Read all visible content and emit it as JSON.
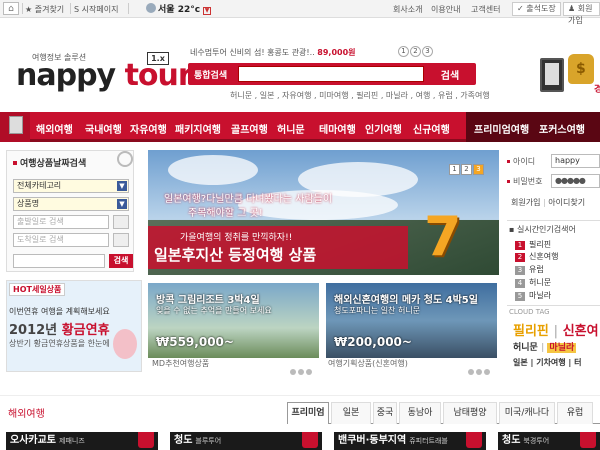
{
  "topbar": {
    "favorites": "즐겨찾기",
    "start_page": "시작페이지",
    "weather_city": "서울",
    "weather_temp": "22°c",
    "links": [
      "회사소개",
      "이용안내",
      "고객센터"
    ],
    "attendance": "출석도장",
    "member": "회원가입"
  },
  "logo": {
    "slogan": "여행정보 솔루션",
    "word_a": "nappy",
    "word_b": "tour",
    "version": "1.x"
  },
  "ticker": {
    "text": "네수멈투어  신비의 섬! 홍콩도 관광!..",
    "points": "89,000원",
    "page_nums": [
      "1",
      "2",
      "3"
    ]
  },
  "search": {
    "label": "통합검색",
    "placeholder": "",
    "button": "검색",
    "keywords": "허니문 , 일본 , 자유여행 , 미마여행 , 필리핀 , 마닐라 , 여행 , 유럽 , 가족여행"
  },
  "right_ad": {
    "text": "경"
  },
  "nav": {
    "items": [
      "해외여행",
      "국내여행",
      "자유여행",
      "패키지여행",
      "골프여행",
      "허니문",
      "테마여행",
      "인기여행",
      "신규여행",
      "프리미엄여행",
      "포커스여행"
    ]
  },
  "left_search": {
    "title": "여행상품날짜검색",
    "select_all": "전체카테고리",
    "select_product": "상품명",
    "depart_date": "출발일로 검색",
    "arrive_date": "도착일로 검색",
    "button": "검색"
  },
  "hot_deal": {
    "tab": "HOT세일상품",
    "line1": "이번연휴 여행을 계획해보세요",
    "line2_year": "2012년",
    "line2_word": "황금연휴",
    "line3": "상반기 황금연휴상품을 한눈에"
  },
  "banner": {
    "line1": "일본여행?다닐만큼 다녀봤다는 사람들이",
    "line2": "주목해야할 그 곳!",
    "line3": "가을여행의 정취를 만끽하자!!",
    "line4": "일본후지산 등정여행 상품",
    "big_number": "7",
    "pager": [
      "1",
      "2",
      "3"
    ]
  },
  "thumbs": [
    {
      "headline": "방콕 그림리조트 3박4일",
      "sub": "잊을 수 없는 추억을 만들어 보세요",
      "price": "₩559,000~",
      "caption": "MD추천여행상품"
    },
    {
      "headline": "해외신혼여행의 메카 청도 4박5일",
      "sub": "청도포파니는 일찬 허니문",
      "price": "₩200,000~",
      "caption": "여행기획상품(신혼여행)"
    }
  ],
  "login": {
    "id_label": "아이디",
    "id_value": "happy",
    "pw_label": "비밀번호",
    "pw_value": "●●●●●",
    "join": "회원가입",
    "find": "아이디찾기"
  },
  "ranking": {
    "title": "실시간인기검색어",
    "items": [
      {
        "n": "1",
        "t": "필리핀"
      },
      {
        "n": "2",
        "t": "신혼여행"
      },
      {
        "n": "3",
        "t": "유럽"
      },
      {
        "n": "4",
        "t": "허니문"
      },
      {
        "n": "5",
        "t": "마닐라"
      }
    ]
  },
  "cloud_tag": {
    "label": "CLOUD TAG",
    "line1_a": "필리핀",
    "line1_b": "신혼여",
    "line2_a": "허니문",
    "line2_b": "마닐라",
    "line3": "일본 | 기차여행 | 터"
  },
  "section": {
    "title": "해외여행",
    "tabs": [
      "프리미엄",
      "일본",
      "중국",
      "동남아",
      "남태평양",
      "미국/캐나다",
      "유럽"
    ]
  },
  "products": [
    {
      "name": "오사카교토",
      "sub": "제패니즈"
    },
    {
      "name": "청도",
      "sub": "블루투어"
    },
    {
      "name": "밴쿠버·동부지역",
      "sub": "쥬피터트래블"
    },
    {
      "name": "청도",
      "sub": "북경투어"
    }
  ],
  "colors": {
    "brand_red": "#c8102e",
    "nav_dark": "#5a0613"
  }
}
